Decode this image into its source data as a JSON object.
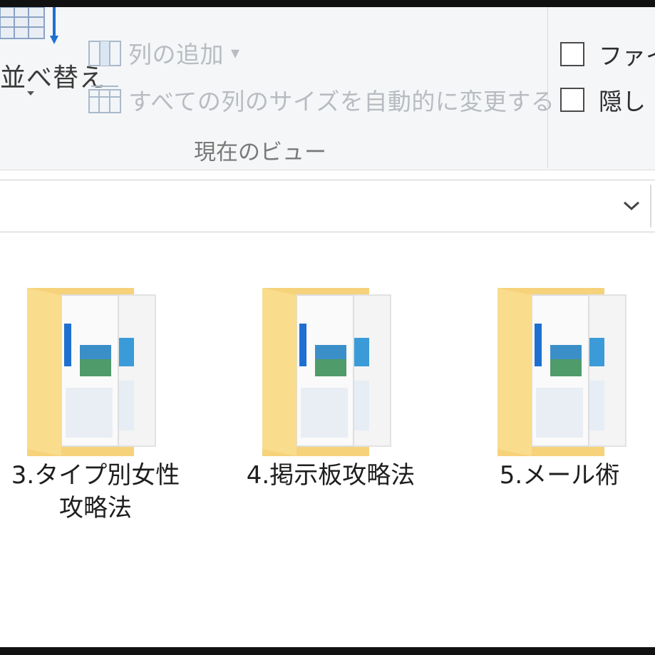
{
  "ribbon": {
    "sort_label": "並べ替え",
    "add_column_label": "列の追加",
    "add_column_caret": "▾",
    "autosize_label": "すべての列のサイズを自動的に変更する",
    "group_label": "現在のビュー",
    "checkbox_file_ext_label": "ファイ",
    "checkbox_hidden_label": "隠し"
  },
  "address_bar": {
    "value": ""
  },
  "folders": [
    {
      "name": "3.タイプ別女性攻略法"
    },
    {
      "name": "4.掲示板攻略法"
    },
    {
      "name": "5.メール術"
    }
  ],
  "colors": {
    "folder_back": "#f6d27a",
    "folder_front": "#f9dc8c",
    "accent_blue": "#1f6fd1"
  }
}
